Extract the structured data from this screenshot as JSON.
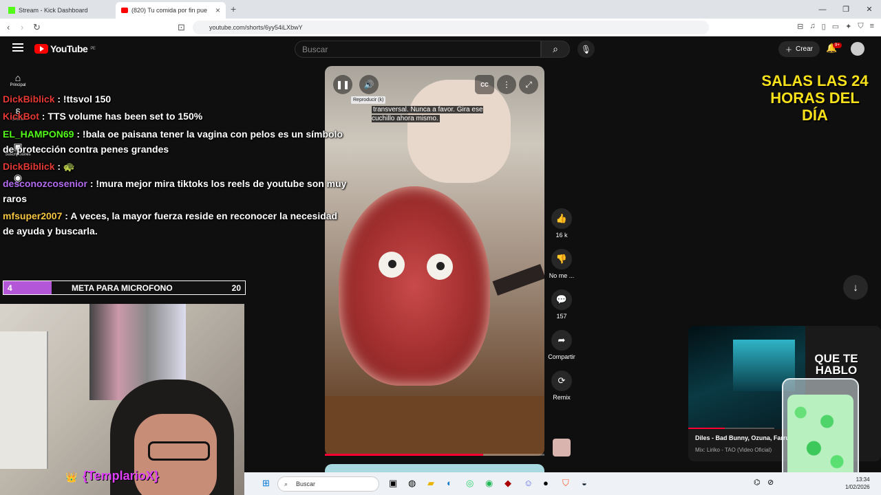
{
  "browser": {
    "tabs": [
      {
        "title": "Stream - Kick Dashboard"
      },
      {
        "title": "(820) Tu comida por fin pued"
      }
    ],
    "url": "youtube.com/shorts/6yy54iLXbwY"
  },
  "youtube": {
    "logo_text": "YouTube",
    "region": "PE",
    "search_placeholder": "Buscar",
    "create_label": "Crear",
    "notif_count": "9+",
    "sidebar": [
      {
        "label": "Principal",
        "icon": "home-icon"
      },
      {
        "label": "Shorts",
        "icon": "shorts-icon"
      },
      {
        "label": "Suscripciones",
        "icon": "subscriptions-icon"
      },
      {
        "label": "Tú",
        "icon": "user-icon"
      }
    ]
  },
  "chat": [
    {
      "user": "DickBiblick",
      "color": "#e53935",
      "text": ": !ttsvol 150"
    },
    {
      "user": "KickBot",
      "color": "#e53935",
      "text": ": TTS volume has been set to 150%"
    },
    {
      "user": "EL_HAMPON69",
      "color": "#53fc18",
      "text": ": !bala oe paisana tener la vagina con pelos es un símbolo de protección contra penes grandes"
    },
    {
      "user": "DickBiblick",
      "color": "#e53935",
      "text": ": 🐢"
    },
    {
      "user": "desconozcosenior",
      "color": "#b36cf0",
      "text": ": !mura mejor mira tiktoks los reels de youtube son muy raros"
    },
    {
      "user": "mfsuper2007",
      "color": "#f5c542",
      "text": ": A veces, la mayor fuerza reside en reconocer la necesidad de ayuda y buscarla."
    }
  ],
  "goal": {
    "current": "4",
    "label": "META PARA MICROFONO",
    "target": "20",
    "fraction": 0.2
  },
  "streamer_name": "{TemplarioX}",
  "player": {
    "tooltip": "Reproducir (k)",
    "caption": "transversal. Nunca a favor. Gira ese cuchillo ahora mismo.",
    "progress": 0.72,
    "cc_label": "CC"
  },
  "actions": [
    {
      "label": "16 k",
      "icon": "like-icon",
      "glyph": "👍"
    },
    {
      "label": "No me ...",
      "icon": "dislike-icon",
      "glyph": "👎"
    },
    {
      "label": "157",
      "icon": "comment-icon",
      "glyph": "💬"
    },
    {
      "label": "Compartir",
      "icon": "share-icon",
      "glyph": "➦"
    },
    {
      "label": "Remix",
      "icon": "remix-icon",
      "glyph": "⟳"
    }
  ],
  "overlay_text": "SALAS LAS 24 HORAS DEL DÍA",
  "miniplayer": {
    "title": "Diles - Bad Bunny, Ozuna, Farru",
    "subtitle": "Mix: Liriko - TAO (Video Oficial)",
    "overlay": "QUE TE HABLO",
    "progress": 0.42
  },
  "taskbar": {
    "search": "Buscar",
    "time": "13:34",
    "date": "1/02/2026"
  }
}
